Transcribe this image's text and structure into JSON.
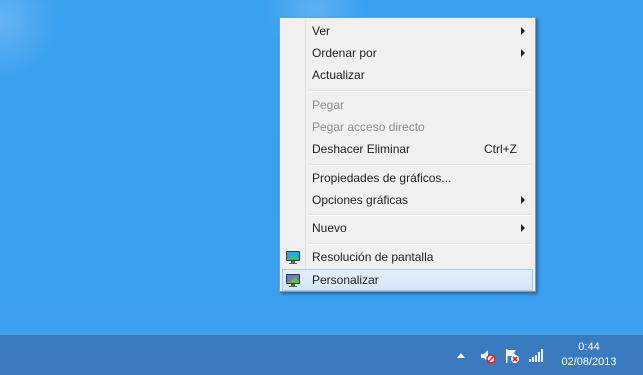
{
  "desktop": {
    "background_color": "#3aa0f0"
  },
  "context_menu": {
    "groups": [
      {
        "items": [
          {
            "label": "Ver",
            "submenu": true
          },
          {
            "label": "Ordenar por",
            "submenu": true
          },
          {
            "label": "Actualizar"
          }
        ]
      },
      {
        "items": [
          {
            "label": "Pegar",
            "disabled": true
          },
          {
            "label": "Pegar acceso directo",
            "disabled": true
          },
          {
            "label": "Deshacer Eliminar",
            "shortcut": "Ctrl+Z"
          }
        ]
      },
      {
        "items": [
          {
            "label": "Propiedades de gráficos..."
          },
          {
            "label": "Opciones gráficas",
            "submenu": true
          }
        ]
      },
      {
        "items": [
          {
            "label": "Nuevo",
            "submenu": true
          }
        ]
      },
      {
        "items": [
          {
            "label": "Resolución de pantalla",
            "icon": "monitor-icon"
          },
          {
            "label": "Personalizar",
            "icon": "monitor-personalize-icon",
            "highlighted": true
          }
        ]
      }
    ]
  },
  "taskbar": {
    "background_color": "#3a7bc0",
    "tray_icons": [
      "show-hidden-icons-arrow",
      "volume-muted-icon",
      "action-center-flag-icon",
      "network-signal-icon"
    ],
    "clock": {
      "time": "0:44",
      "date": "02/08/2013"
    }
  }
}
